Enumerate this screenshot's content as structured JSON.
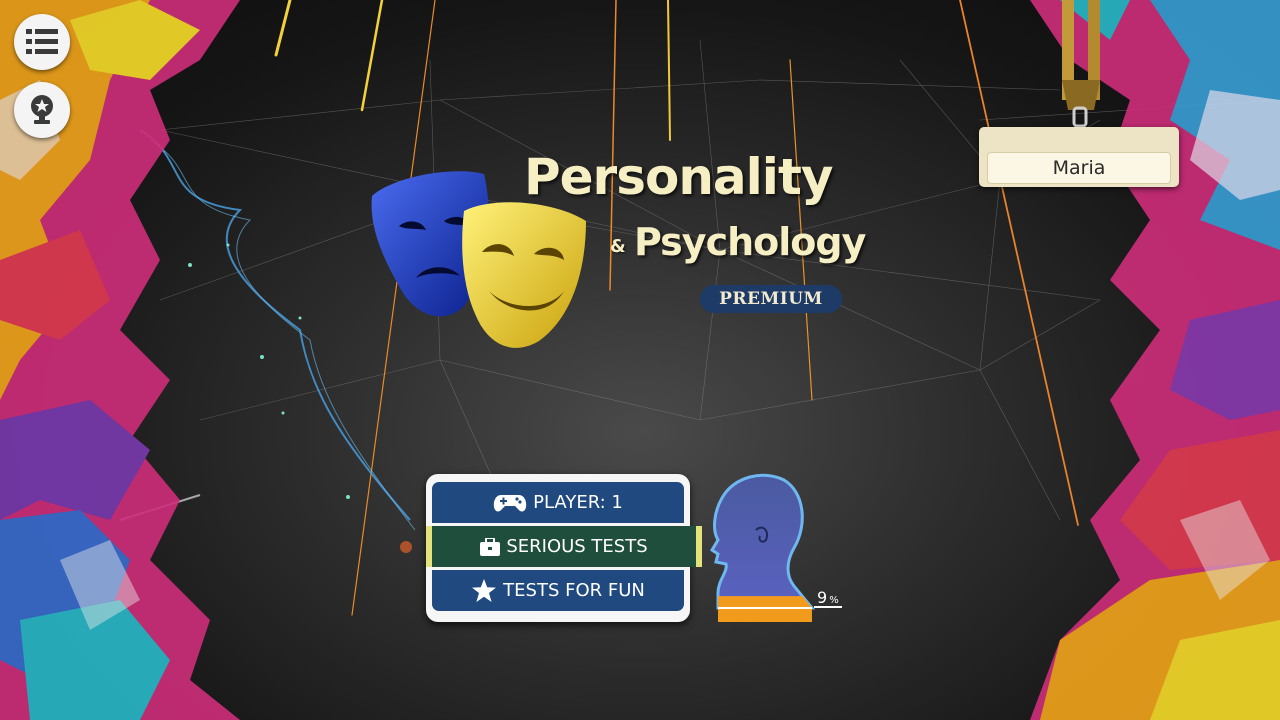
{
  "title": {
    "line1": "Personality",
    "amp": "&",
    "line2": "Psychology",
    "edition": "PREMIUM"
  },
  "icons": {
    "menu": "list-icon",
    "achievements": "trophy-icon",
    "player": "gamepad-icon",
    "serious": "briefcase-icon",
    "fun": "star-icon"
  },
  "badge": {
    "name": "Maria"
  },
  "menu": {
    "items": [
      {
        "label": "PLAYER: 1"
      },
      {
        "label": "SERIOUS TESTS"
      },
      {
        "label": "TESTS FOR FUN"
      }
    ]
  },
  "progress": {
    "value": "9",
    "unit": "%",
    "fraction": 0.09
  },
  "colors": {
    "menu_blue": "#1f497f",
    "selected_green": "#1f4f3c",
    "selected_border": "#e4e27a",
    "title_cream": "#f6efc4",
    "progress_orange": "#f29a1c"
  }
}
